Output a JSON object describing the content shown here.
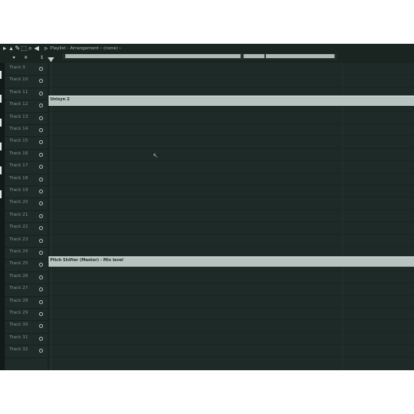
{
  "window": {
    "title": "Playlist - Arrangement › (none) ›"
  },
  "tracks": [
    {
      "label": "Track 9"
    },
    {
      "label": "Track 10"
    },
    {
      "label": "Track 11"
    },
    {
      "label": "Track 12"
    },
    {
      "label": "Track 13"
    },
    {
      "label": "Track 14"
    },
    {
      "label": "Track 15"
    },
    {
      "label": "Track 16"
    },
    {
      "label": "Track 17"
    },
    {
      "label": "Track 18"
    },
    {
      "label": "Track 19"
    },
    {
      "label": "Track 20"
    },
    {
      "label": "Track 21"
    },
    {
      "label": "Track 22"
    },
    {
      "label": "Track 23"
    },
    {
      "label": "Track 24"
    },
    {
      "label": "Track 25"
    },
    {
      "label": "Track 26"
    },
    {
      "label": "Track 27"
    },
    {
      "label": "Track 28"
    },
    {
      "label": "Track 29"
    },
    {
      "label": "Track 30"
    },
    {
      "label": "Track 31"
    },
    {
      "label": "Track 32"
    }
  ],
  "clips": [
    {
      "label": "Unisyn 2"
    },
    {
      "label": "Pitch Shifter (Master) - Mix level"
    }
  ],
  "icons": {
    "play": "▸",
    "magnet": "⌖",
    "cursor": "↖"
  },
  "colors": {
    "background": "#1e2a27",
    "clip": "#b8c4bf",
    "label": "#7f8d88"
  }
}
